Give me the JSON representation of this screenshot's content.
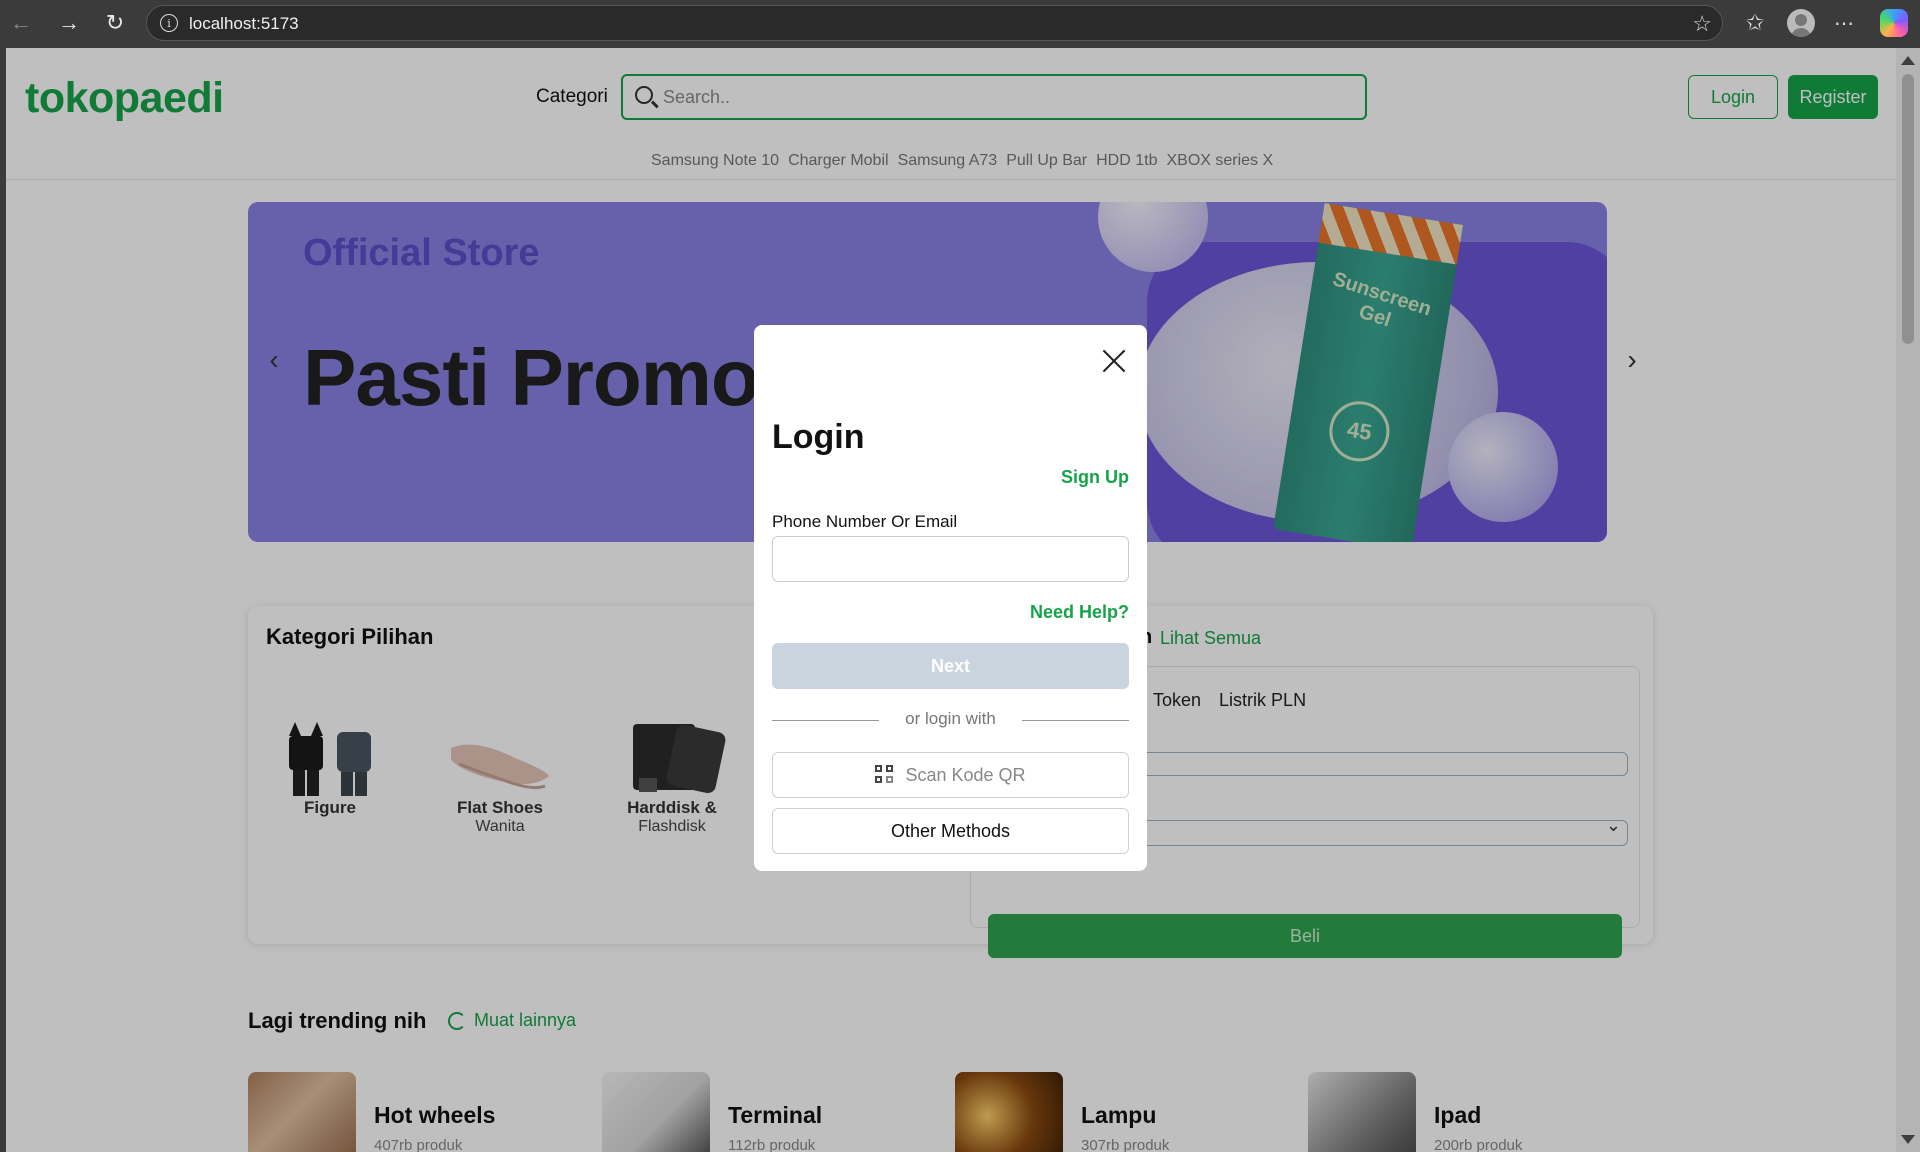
{
  "browser": {
    "url": "localhost:5173"
  },
  "header": {
    "logo": "tokopaedi",
    "categori_label": "Categori",
    "search_placeholder": "Search..",
    "login_label": "Login",
    "register_label": "Register",
    "suggestions": [
      "Samsung Note 10",
      "Charger Mobil",
      "Samsung A73",
      "Pull Up Bar",
      "HDD 1tb",
      "XBOX series X"
    ]
  },
  "banner": {
    "kicker": "Official Store",
    "headline": "Pasti Promo",
    "product_text": "Sunscreen Gel",
    "badge": "45"
  },
  "kategori": {
    "title": "Kategori Pilihan",
    "items": [
      {
        "line1": "Figure",
        "line2": ""
      },
      {
        "line1": "Flat Shoes",
        "line2": "Wanita"
      },
      {
        "line1": "Harddisk &",
        "line2": "Flashdisk"
      }
    ]
  },
  "topup": {
    "heading_fragment": "n",
    "see_all": "Lihat Semua",
    "tabs": [
      "Token",
      "Listrik PLN"
    ],
    "buy_label": "Beli"
  },
  "trending": {
    "title": "Lagi trending nih",
    "reload_label": "Muat lainnya",
    "items": [
      {
        "name": "Hot wheels",
        "count": "407rb produk"
      },
      {
        "name": "Terminal",
        "count": "112rb produk"
      },
      {
        "name": "Lampu",
        "count": "307rb produk"
      },
      {
        "name": "Ipad",
        "count": "200rb produk"
      }
    ]
  },
  "login_modal": {
    "title": "Login",
    "signup_link": "Sign Up",
    "field_label": "Phone Number Or Email",
    "field_value": "",
    "help_link": "Need Help?",
    "next_label": "Next",
    "divider_text": "or login with",
    "qr_label": "Scan Kode QR",
    "other_label": "Other Methods"
  },
  "colors": {
    "brand_green": "#16a34a",
    "disabled_button": "#c9d4df",
    "banner_purple": "#8a82e6"
  }
}
